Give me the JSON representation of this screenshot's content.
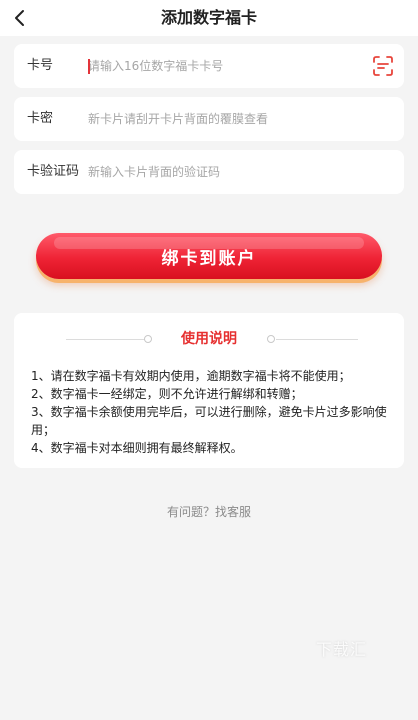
{
  "header": {
    "title": "添加数字福卡",
    "back_icon": "chevron-left-icon"
  },
  "form": {
    "card_number": {
      "label": "卡号",
      "placeholder": "请输入16位数字福卡卡号",
      "value": "",
      "scan_icon": "scan-icon"
    },
    "card_password": {
      "label": "卡密",
      "placeholder": "新卡片请刮开卡片背面的覆膜查看",
      "value": ""
    },
    "card_code": {
      "label": "卡验证码",
      "placeholder": "新输入卡片背面的验证码",
      "value": ""
    }
  },
  "bind_button": {
    "label": "绑卡到账户"
  },
  "instructions": {
    "title": "使用说明",
    "items": [
      "1、请在数字福卡有效期内使用，逾期数字福卡将不能使用；",
      "2、数字福卡一经绑定，则不允许进行解绑和转赠；",
      "3、数字福卡余额使用完毕后，可以进行删除，避免卡片过多影响使用；",
      "4、数字福卡对本细则拥有最终解释权。"
    ]
  },
  "help": {
    "label": "有问题？找客服"
  },
  "watermark": {
    "text": "下载汇"
  },
  "colors": {
    "accent": "#ef2335",
    "title_red": "#e63030",
    "background": "#f4f4f4"
  }
}
